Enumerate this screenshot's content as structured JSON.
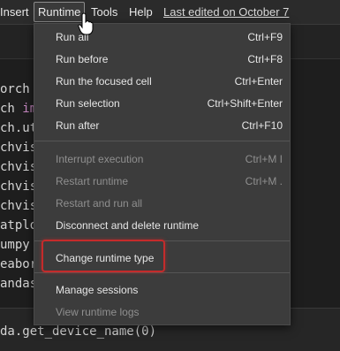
{
  "menubar": {
    "items": [
      "Insert",
      "Runtime",
      "Tools",
      "Help"
    ],
    "edited": "Last edited on October 7"
  },
  "code_lines": [
    {
      "text": "orch",
      "highlight": ""
    },
    {
      "text": "ch ",
      "highlight": "im"
    },
    {
      "text": "ch.ut",
      "highlight": ""
    },
    {
      "text": "chvis",
      "highlight": ""
    },
    {
      "text": "chvis",
      "highlight": ""
    },
    {
      "text": "chvis",
      "highlight": ""
    },
    {
      "text": "chvis",
      "highlight": ""
    },
    {
      "text": "atplo",
      "highlight": ""
    },
    {
      "text": "umpy",
      "highlight": ""
    },
    {
      "text": "eabor",
      "highlight": ""
    },
    {
      "text": "andas",
      "highlight": ""
    }
  ],
  "bottom_code": "da.get_device_name(0)",
  "runtime_menu": {
    "items": [
      {
        "label": "Run all",
        "shortcut": "Ctrl+F9",
        "disabled": false
      },
      {
        "label": "Run before",
        "shortcut": "Ctrl+F8",
        "disabled": false
      },
      {
        "label": "Run the focused cell",
        "shortcut": "Ctrl+Enter",
        "disabled": false
      },
      {
        "label": "Run selection",
        "shortcut": "Ctrl+Shift+Enter",
        "disabled": false
      },
      {
        "label": "Run after",
        "shortcut": "Ctrl+F10",
        "disabled": false
      },
      {
        "label": "Interrupt execution",
        "shortcut": "Ctrl+M I",
        "disabled": true
      },
      {
        "label": "Restart runtime",
        "shortcut": "Ctrl+M .",
        "disabled": true
      },
      {
        "label": "Restart and run all",
        "shortcut": "",
        "disabled": true
      },
      {
        "label": "Disconnect and delete runtime",
        "shortcut": "",
        "disabled": false
      },
      {
        "label": "Change runtime type",
        "shortcut": "",
        "disabled": false
      },
      {
        "label": "Manage sessions",
        "shortcut": "",
        "disabled": false
      },
      {
        "label": "View runtime logs",
        "shortcut": "",
        "disabled": true
      }
    ],
    "highlighted_item": "Change runtime type"
  },
  "colors": {
    "menu_bg": "#3c3c3c",
    "highlight_border": "#c42b2b",
    "disabled_text": "#8f8f8f"
  },
  "icons": [
    "mouse-pointer-hand-icon"
  ]
}
